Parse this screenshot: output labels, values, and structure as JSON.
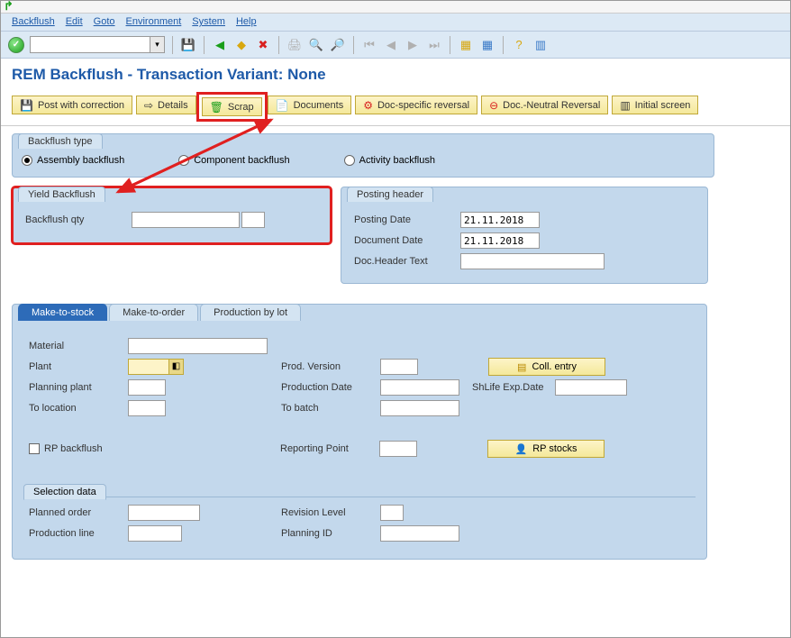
{
  "menu": {
    "backflush": "Backflush",
    "edit": "Edit",
    "goto": "Goto",
    "environment": "Environment",
    "system": "System",
    "help": "Help"
  },
  "title": "REM Backflush - Transaction Variant: None",
  "buttons": {
    "post_correction": "Post with correction",
    "details": "Details",
    "scrap": "Scrap",
    "documents": "Documents",
    "doc_specific": "Doc-specific reversal",
    "doc_neutral": "Doc.-Neutral Reversal",
    "initial": "Initial screen"
  },
  "backflush_type": {
    "legend": "Backflush type",
    "assembly": "Assembly backflush",
    "component": "Component backflush",
    "activity": "Activity backflush"
  },
  "yield": {
    "legend": "Yield Backflush",
    "qty_label": "Backflush qty",
    "qty_value": "",
    "uom_value": ""
  },
  "posting": {
    "legend": "Posting header",
    "posting_date_label": "Posting Date",
    "posting_date_value": "21.11.2018",
    "doc_date_label": "Document Date",
    "doc_date_value": "21.11.2018",
    "header_text_label": "Doc.Header Text",
    "header_text_value": ""
  },
  "tabs": {
    "mts": "Make-to-stock",
    "mto": "Make-to-order",
    "prod_lot": "Production by lot"
  },
  "main_form": {
    "material": "Material",
    "material_val": "",
    "plant": "Plant",
    "plant_val": "",
    "planning_plant": "Planning plant",
    "planning_plant_val": "",
    "to_location": "To location",
    "to_location_val": "",
    "prod_version": "Prod. Version",
    "prod_version_val": "",
    "production_date": "Production Date",
    "production_date_val": "",
    "to_batch": "To batch",
    "to_batch_val": "",
    "shlife": "ShLife Exp.Date",
    "shlife_val": "",
    "coll_entry": "Coll. entry",
    "rp_backflush": "RP backflush",
    "reporting_point": "Reporting Point",
    "reporting_point_val": "",
    "rp_stocks": "RP stocks"
  },
  "selection": {
    "legend": "Selection data",
    "planned_order": "Planned order",
    "planned_order_val": "",
    "production_line": "Production line",
    "production_line_val": "",
    "revision_level": "Revision Level",
    "revision_level_val": "",
    "planning_id": "Planning ID",
    "planning_id_val": ""
  }
}
